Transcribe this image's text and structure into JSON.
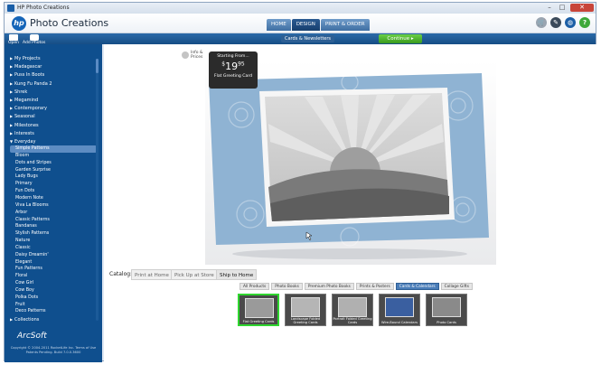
{
  "window": {
    "title": "HP Photo Creations",
    "min": "–",
    "max": "□",
    "close": "✕"
  },
  "header": {
    "app_title": "Photo Creations",
    "logo_text": "hp",
    "tabs": [
      {
        "label": "HOME",
        "active": false
      },
      {
        "label": "DESIGN",
        "active": true
      },
      {
        "label": "PRINT & ORDER",
        "active": false
      }
    ],
    "icons": [
      {
        "name": "cart-icon",
        "glyph": "🛒",
        "color": "#9aa5b1"
      },
      {
        "name": "help-tips-icon",
        "glyph": "✎",
        "color": "#3b4a5a"
      },
      {
        "name": "globe-icon",
        "glyph": "◍",
        "color": "#1d5fa6"
      },
      {
        "name": "question-icon",
        "glyph": "?",
        "color": "#3ea83a"
      }
    ]
  },
  "subbar": {
    "section_label": "Cards & Newsletters",
    "continue_label": "Continue ▸"
  },
  "sidebar": {
    "tools": [
      {
        "label": "Open"
      },
      {
        "label": "Add Photos"
      }
    ],
    "categories": [
      {
        "label": "My Projects",
        "expanded": false
      },
      {
        "label": "Madagascar",
        "expanded": false
      },
      {
        "label": "Puss In Boots",
        "expanded": false
      },
      {
        "label": "Kung Fu Panda 2",
        "expanded": false
      },
      {
        "label": "Shrek",
        "expanded": false
      },
      {
        "label": "Megamind",
        "expanded": false
      },
      {
        "label": "Contemporary",
        "expanded": false
      },
      {
        "label": "Seasonal",
        "expanded": false
      },
      {
        "label": "Milestones",
        "expanded": false
      },
      {
        "label": "Interests",
        "expanded": false
      },
      {
        "label": "Everyday",
        "expanded": true
      }
    ],
    "subitems": [
      {
        "label": "Simple Patterns",
        "selected": true
      },
      {
        "label": "Bloom",
        "selected": false
      },
      {
        "label": "Dots and Stripes",
        "selected": false
      },
      {
        "label": "Garden Surprise",
        "selected": false
      },
      {
        "label": "Lady Bugs",
        "selected": false
      },
      {
        "label": "Primary",
        "selected": false
      },
      {
        "label": "Fun Dots",
        "selected": false
      },
      {
        "label": "Modern Note",
        "selected": false
      },
      {
        "label": "Viva La Blooms",
        "selected": false
      },
      {
        "label": "Arbor",
        "selected": false
      },
      {
        "label": "Classic Patterns",
        "selected": false
      },
      {
        "label": "Bandanas",
        "selected": false
      },
      {
        "label": "Stylish Patterns",
        "selected": false
      },
      {
        "label": "Nature",
        "selected": false
      },
      {
        "label": "Classic",
        "selected": false
      },
      {
        "label": "Daisy Dreamin'",
        "selected": false
      },
      {
        "label": "Elegant",
        "selected": false
      },
      {
        "label": "Fun Patterns",
        "selected": false
      },
      {
        "label": "Floral",
        "selected": false
      },
      {
        "label": "Cow Girl",
        "selected": false
      },
      {
        "label": "Cow Boy",
        "selected": false
      },
      {
        "label": "Polka Dots",
        "selected": false
      },
      {
        "label": "Fruit",
        "selected": false
      },
      {
        "label": "Deco Patterns",
        "selected": false
      }
    ],
    "after_categories": [
      {
        "label": "Collections"
      }
    ],
    "footer_logo": "ArcSoft",
    "footer_copy": "Copyright © 2004-2011 RocketLife Inc. Terms of Use  Patents Pending. Build 7.0.0.3600"
  },
  "main": {
    "info_label": "Info & Prices",
    "price": {
      "top": "Starting From...",
      "currency": "$",
      "dollars": "19",
      "cents": "95",
      "product": "Flat Greeting Card"
    },
    "catalog": {
      "label": "Catalog:",
      "tabs": [
        {
          "label": "Print at Home",
          "active": false
        },
        {
          "label": "Pick Up at Store",
          "active": false
        },
        {
          "label": "Ship to Home",
          "active": true
        }
      ]
    },
    "product_tabs": [
      {
        "label": "All Products",
        "active": false
      },
      {
        "label": "Photo Books",
        "active": false
      },
      {
        "label": "Premium Photo Books",
        "active": false
      },
      {
        "label": "Prints & Posters",
        "active": false
      },
      {
        "label": "Cards & Calendars",
        "active": true
      },
      {
        "label": "Collage Gifts",
        "active": false
      }
    ],
    "thumbnails": [
      {
        "label": "Flat Greeting Cards",
        "selected": true
      },
      {
        "label": "Landscape Folded Greeting Cards",
        "selected": false
      },
      {
        "label": "Portrait Folded Greeting Cards",
        "selected": false
      },
      {
        "label": "Wire-Bound Calendars",
        "selected": false
      },
      {
        "label": "Photo Cards",
        "selected": false
      }
    ]
  },
  "colors": {
    "accent": "#1565b8",
    "sidebar": "#0f4f8e",
    "continue": "#4cb72a",
    "selected_thumb": "#2fd62f",
    "card_blue": "#8fb3d3"
  }
}
